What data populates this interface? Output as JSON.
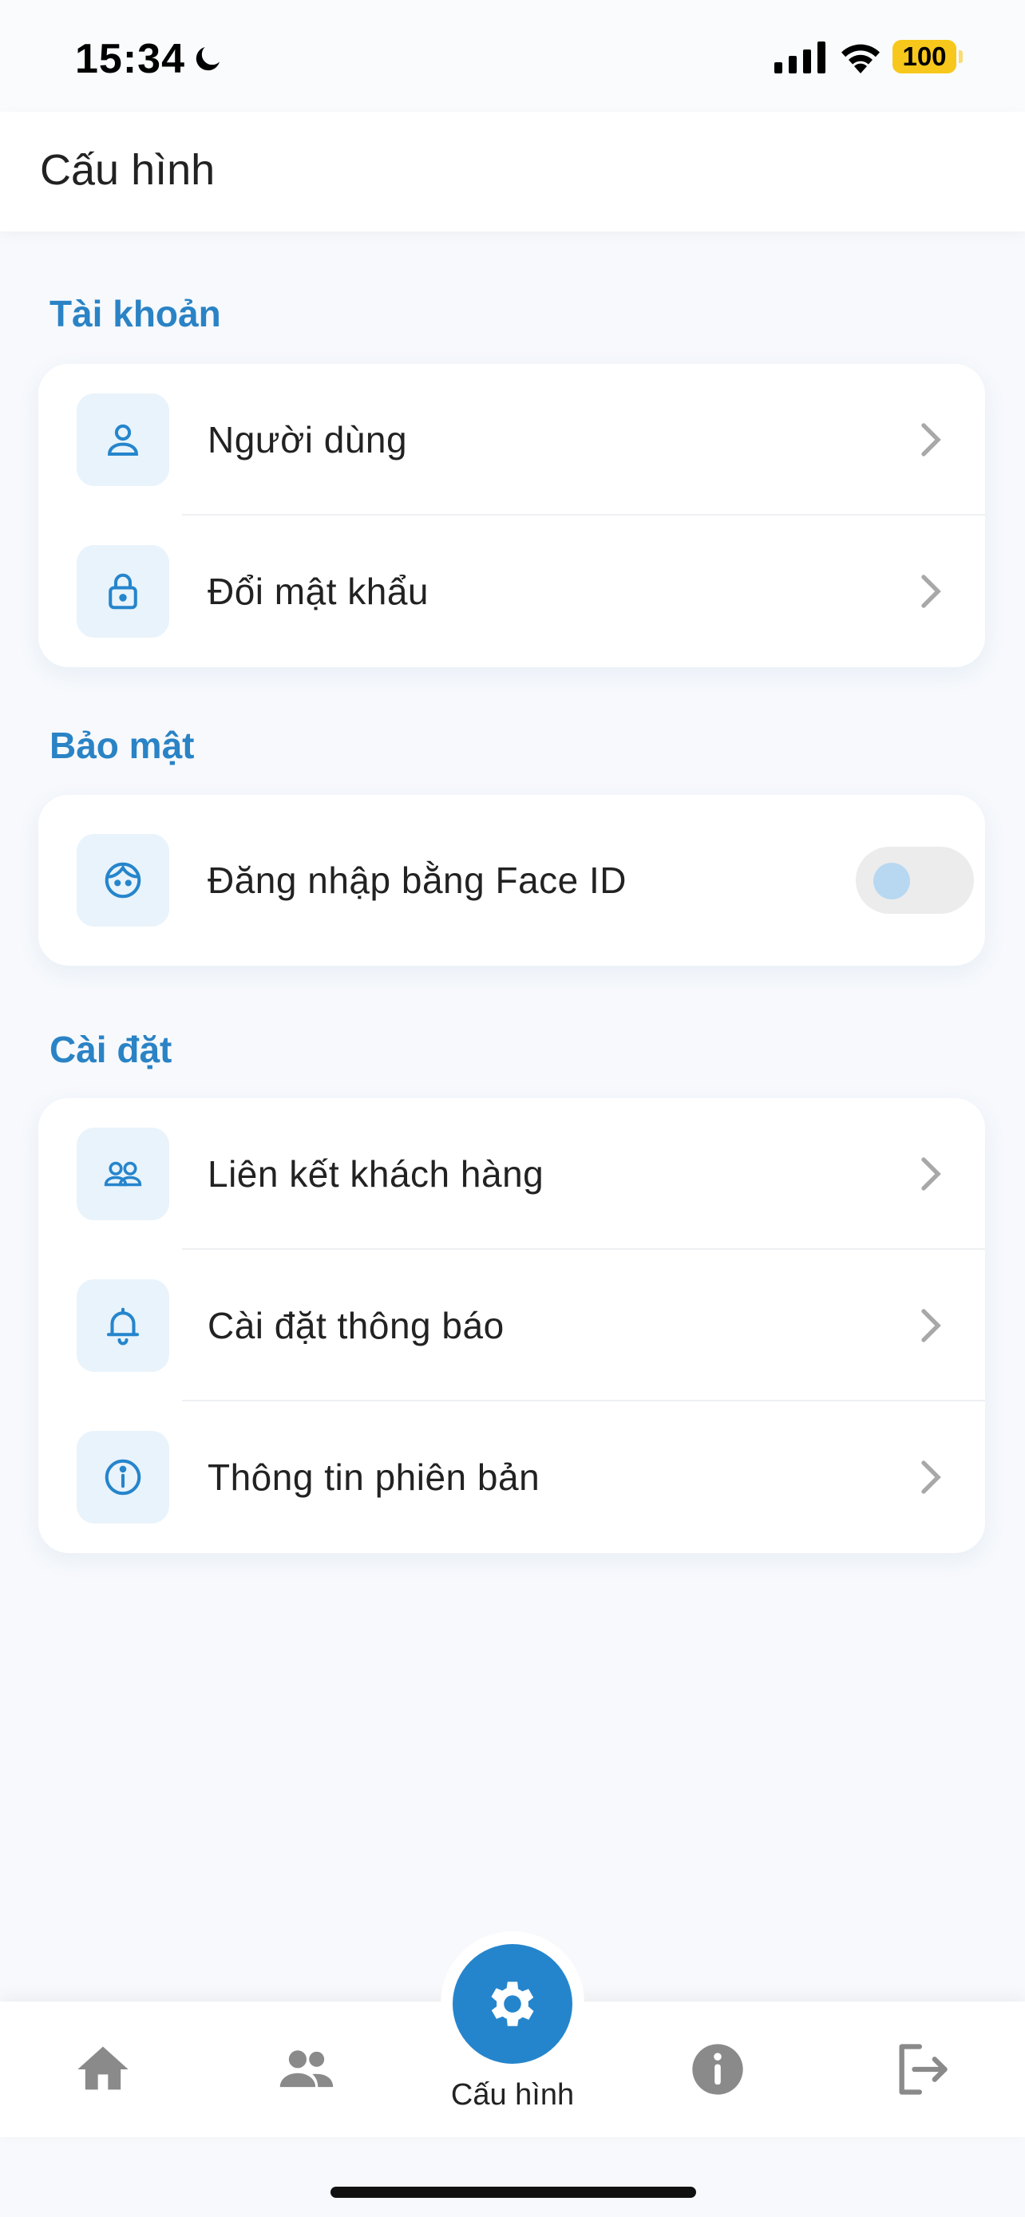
{
  "status_bar": {
    "time": "15:34",
    "battery": "100",
    "icons": [
      "moon-icon",
      "signal-icon",
      "wifi-icon",
      "battery-icon"
    ]
  },
  "header": {
    "title": "Cấu hình"
  },
  "sections": {
    "account": {
      "title": "Tài khoản",
      "items": [
        {
          "label": "Người dùng",
          "icon": "user-icon"
        },
        {
          "label": "Đổi mật khẩu",
          "icon": "lock-icon"
        }
      ]
    },
    "security": {
      "title": "Bảo mật",
      "items": [
        {
          "label": "Đăng nhập bằng Face ID",
          "icon": "face-id-icon",
          "toggle_on": false
        }
      ]
    },
    "settings": {
      "title": "Cài đặt",
      "items": [
        {
          "label": "Liên kết khách hàng",
          "icon": "users-icon"
        },
        {
          "label": "Cài đặt thông báo",
          "icon": "bell-icon"
        },
        {
          "label": "Thông tin phiên bản",
          "icon": "info-icon"
        }
      ]
    }
  },
  "bottom_nav": {
    "items": [
      {
        "icon": "home-icon"
      },
      {
        "icon": "group-icon"
      },
      {
        "icon": "settings-gear-icon",
        "label": "Cấu hình",
        "active": true
      },
      {
        "icon": "info-circle-icon"
      },
      {
        "icon": "logout-icon"
      }
    ]
  },
  "colors": {
    "accent": "#2585cc",
    "section_title": "#2a83c5",
    "icon_bg": "#e9f3fb",
    "battery": "#f7c81b"
  }
}
